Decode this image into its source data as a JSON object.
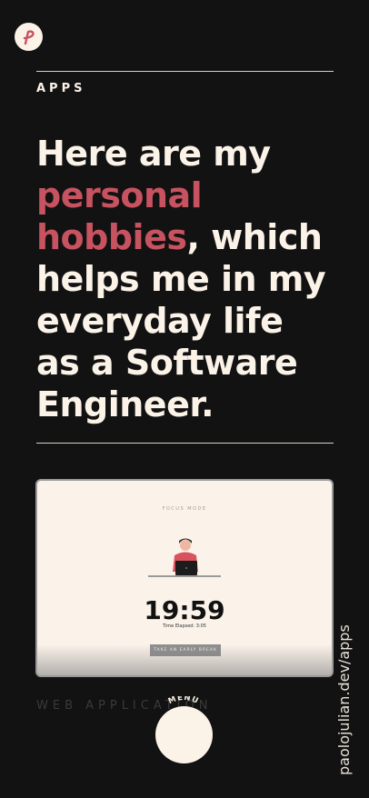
{
  "header": {
    "logo_label": "P"
  },
  "section": {
    "label": "APPS"
  },
  "headline": {
    "before": "Here are my ",
    "highlight": "personal hobbies",
    "after": ", which helps me in my everyday life as a Software Engineer."
  },
  "project": {
    "screenshot": {
      "mode_label": "FOCUS MODE",
      "time": "19:59",
      "elapsed": "Time Elapsed: 3:05",
      "button_label": "TAKE AN EARLY BREAK"
    },
    "type_label": "WEB APPLICATION"
  },
  "menu": {
    "label": "MENU"
  },
  "footer": {
    "url": "paolojulian.dev/apps"
  },
  "colors": {
    "background": "#121212",
    "cream": "#fbf2e8",
    "accent": "#c75260"
  }
}
